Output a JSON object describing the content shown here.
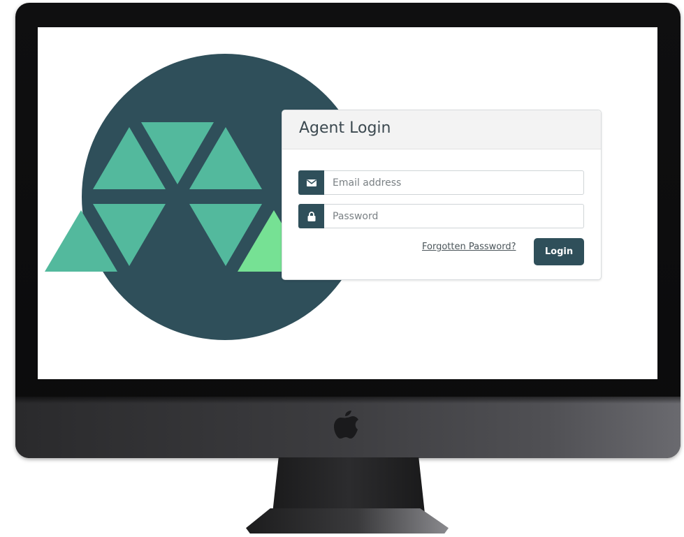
{
  "login": {
    "title": "Agent Login",
    "email_placeholder": "Email address",
    "password_placeholder": "Password",
    "forgot_label": "Forgotten Password?",
    "login_label": "Login"
  },
  "icons": {
    "email": "envelope-icon",
    "password": "lock-icon",
    "brand": "apple-logo"
  },
  "colors": {
    "brand_dark": "#2f4f5a",
    "triangle_teal": "#53b99d",
    "triangle_light": "#76e194",
    "card_header_bg": "#f3f3f3"
  }
}
